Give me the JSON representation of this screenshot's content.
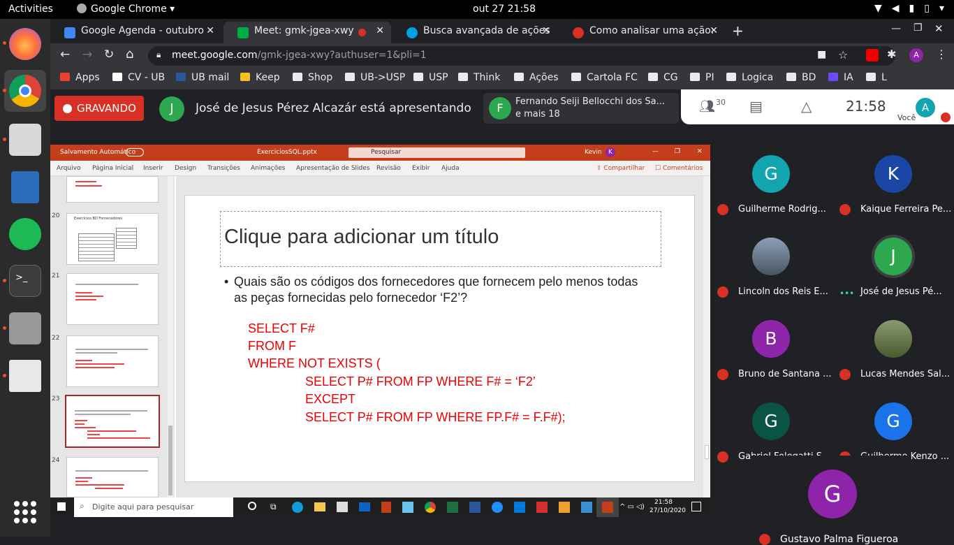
{
  "system": {
    "activities": "Activities",
    "app_menu": "Google Chrome",
    "clock": "out 27  21:58"
  },
  "browser": {
    "tabs": [
      {
        "label": "Google Agenda - outubro",
        "favicon_color": "#4285f4",
        "active": false
      },
      {
        "label": "Meet: gmk-jgea-xwy",
        "favicon_color": "#00ac47",
        "active": true
      },
      {
        "label": "Busca avançada de ações",
        "favicon_color": "#00a1e0",
        "active": false
      },
      {
        "label": "Como analisar uma ação:",
        "favicon_color": "#d93025",
        "active": false
      }
    ],
    "url_host": "meet.google.com",
    "url_rest": "/gmk-jgea-xwy?authuser=1&pli=1",
    "bookmarks": [
      "Apps",
      "CV - UB",
      "UB mail",
      "Keep",
      "Shop",
      "UB->USP",
      "USP",
      "Think",
      "Ações",
      "Cartola FC",
      "CG",
      "PI",
      "Logica",
      "BD",
      "IA",
      "L"
    ]
  },
  "meet": {
    "recording_label": "GRAVANDO",
    "presenter_initial": "J",
    "presenting_text": "José de Jesus Pérez Alcazár está apresentando",
    "other_presenter_initial": "F",
    "other_presenter_line1": "Fernando Seiji Bellocchi dos Sa...",
    "other_presenter_line2": "e mais 18",
    "participant_count": "30",
    "time": "21:58",
    "self_label": "Você",
    "self_initial": "A",
    "participants": [
      {
        "initial": "G",
        "name": "Guilherme Rodrig...",
        "color": "#12a4af",
        "muted": true
      },
      {
        "initial": "K",
        "name": "Kaique Ferreira Pe...",
        "color": "#1a47a5",
        "muted": true
      },
      {
        "initial": "",
        "name": "Lincoln dos Reis E...",
        "color": "#5a6270",
        "muted": true
      },
      {
        "initial": "J",
        "name": "José de Jesus Pé...",
        "color": "#2ea84e",
        "muted": false
      },
      {
        "initial": "B",
        "name": "Bruno de Santana ...",
        "color": "#8e24aa",
        "muted": true
      },
      {
        "initial": "",
        "name": "Lucas Mendes Sal...",
        "color": "#6a7a5a",
        "muted": true
      },
      {
        "initial": "G",
        "name": "Gabriel Folegatti S...",
        "color": "#0b5345",
        "muted": true
      },
      {
        "initial": "G",
        "name": "Guilherme Kenzo ...",
        "color": "#1a73e8",
        "muted": true
      }
    ],
    "bottom_participant": {
      "initial": "G",
      "name": "Gustavo Palma Figueroa",
      "color": "#8e24aa"
    }
  },
  "powerpoint": {
    "autosave": "Salvamento Automático",
    "filename": "ExerciciosSQL.pptx",
    "search": "Pesquisar",
    "user": "Kevin",
    "user_initial": "K",
    "menu": [
      "Arquivo",
      "Página Inicial",
      "Inserir",
      "Design",
      "Transições",
      "Animações",
      "Apresentação de Slides",
      "Revisão",
      "Exibir",
      "Ajuda"
    ],
    "share": "Compartilhar",
    "comments": "Comentários",
    "thumbnails": [
      {
        "num": "20",
        "title": "Exercícios BD Fornecedores"
      },
      {
        "num": "21",
        "title": ""
      },
      {
        "num": "22",
        "title": ""
      },
      {
        "num": "23",
        "title": ""
      },
      {
        "num": "24",
        "title": ""
      }
    ],
    "slide_title": "Clique para adicionar um título",
    "bullet": "•",
    "question": "Quais são os códigos dos fornecedores que fornecem pelo menos todas as peças fornecidas pelo fornecedor ‘F2’?",
    "code_lines": [
      "SELECT F#",
      "FROM F",
      "WHERE NOT EXISTS (",
      "SELECT P#  FROM FP WHERE F# = ‘F2’",
      "EXCEPT",
      "SELECT P# FROM FP WHERE FP.F# = F.F#);"
    ]
  },
  "taskbar": {
    "search_placeholder": "Digite aqui para pesquisar",
    "time": "21:58",
    "date": "27/10/2020"
  }
}
